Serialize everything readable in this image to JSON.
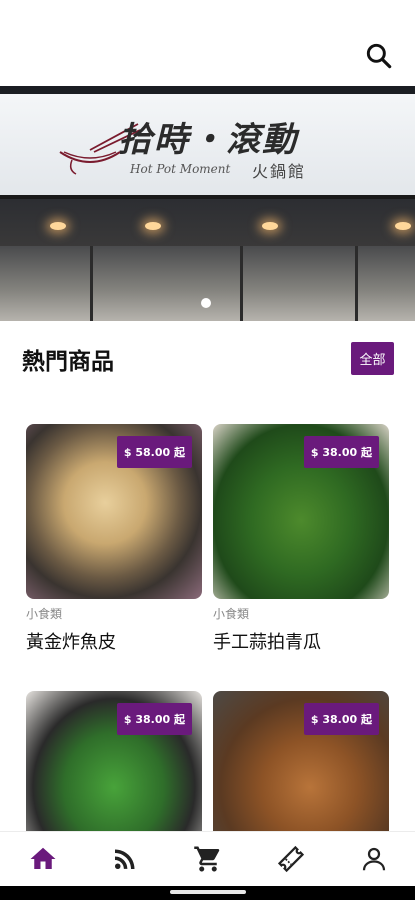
{
  "header": {
    "search_icon": "search-icon"
  },
  "banner": {
    "sign_title": "拾時・滾動",
    "sign_subtitle_en": "Hot Pot Moment",
    "sign_subtitle_zh": "火鍋館",
    "active_slide": 1,
    "slide_count": 1
  },
  "section": {
    "title": "熱門商品",
    "all_label": "全部"
  },
  "products": [
    {
      "price": "$ 58.00 起",
      "category": "小食類",
      "name": "黃金炸魚皮"
    },
    {
      "price": "$ 38.00 起",
      "category": "小食類",
      "name": "手工蒜拍青瓜"
    },
    {
      "price": "$ 38.00 起",
      "category": "",
      "name": ""
    },
    {
      "price": "$ 38.00 起",
      "category": "",
      "name": ""
    }
  ],
  "nav": {
    "items": [
      "home-icon",
      "rss-feed-icon",
      "cart-icon",
      "ticket-icon",
      "profile-icon"
    ],
    "active_color": "#6a1a7c",
    "inactive_color": "#222222"
  },
  "colors": {
    "accent": "#6a1a7c"
  }
}
